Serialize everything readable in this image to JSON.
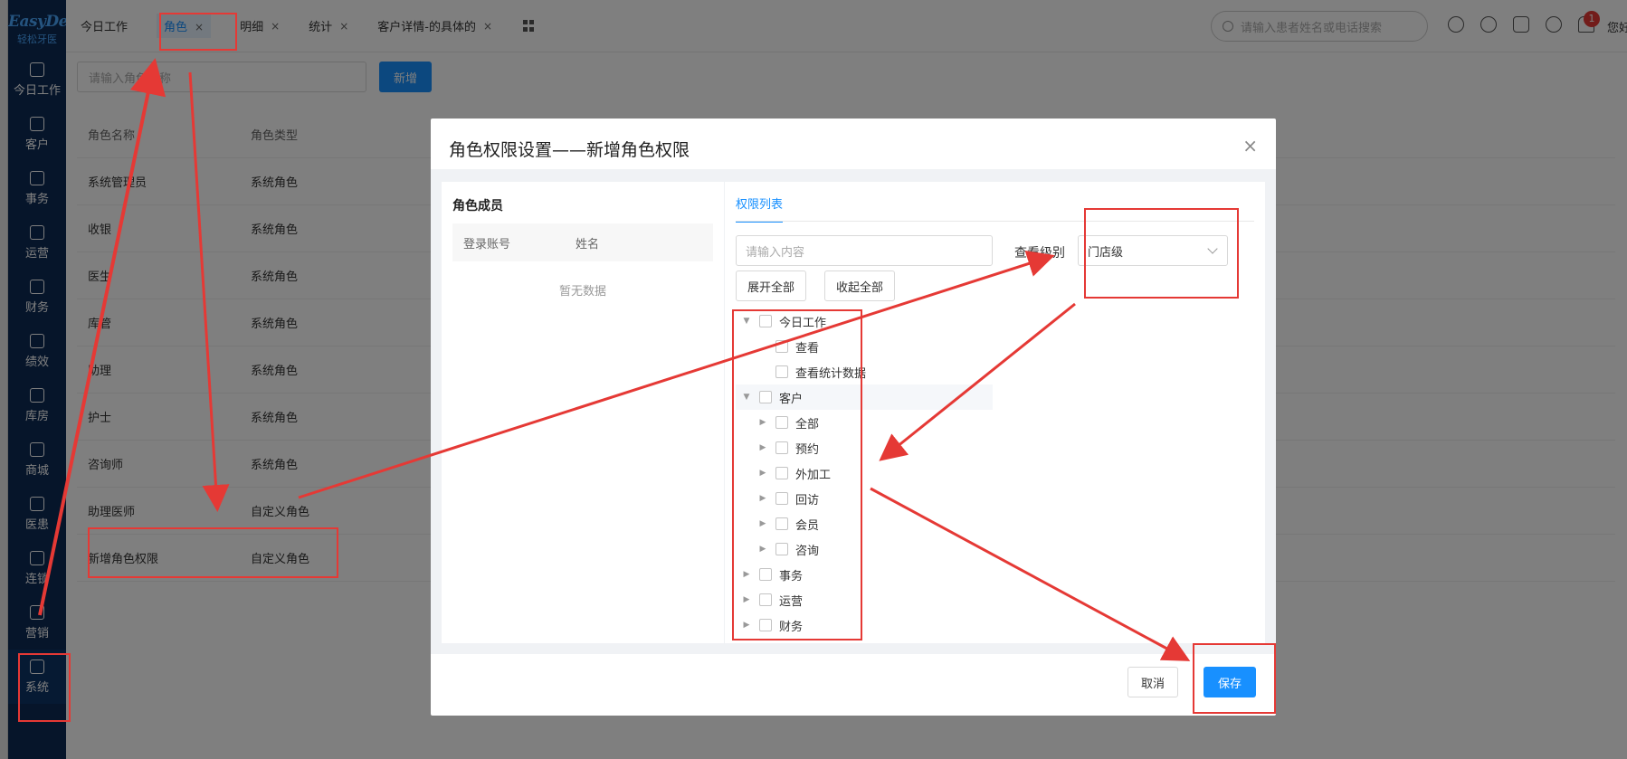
{
  "app": {
    "logo_en": "EasyDent",
    "logo_cn": "轻松牙医"
  },
  "sidebar": {
    "items": [
      {
        "label": "今日工作",
        "icon": "home-icon"
      },
      {
        "label": "客户",
        "icon": "customer-icon"
      },
      {
        "label": "事务",
        "icon": "task-icon"
      },
      {
        "label": "运营",
        "icon": "pie-chart-icon"
      },
      {
        "label": "财务",
        "icon": "finance-icon"
      },
      {
        "label": "绩效",
        "icon": "line-chart-icon"
      },
      {
        "label": "库房",
        "icon": "warehouse-icon"
      },
      {
        "label": "商城",
        "icon": "store-icon"
      },
      {
        "label": "医患",
        "icon": "doctor-patient-icon"
      },
      {
        "label": "连锁",
        "icon": "chain-icon"
      },
      {
        "label": "营销",
        "icon": "target-icon"
      },
      {
        "label": "系统",
        "icon": "gear-icon"
      }
    ]
  },
  "tabs": [
    {
      "label": "今日工作"
    },
    {
      "label": "角色"
    },
    {
      "label": "明细"
    },
    {
      "label": "统计"
    },
    {
      "label": "客户详情-的具体的"
    }
  ],
  "header": {
    "search_placeholder": "请输入患者姓名或电话搜索",
    "notification_count": "1",
    "user_text": "您好"
  },
  "roles": {
    "name_placeholder": "请输入角色名称",
    "add_label": "新增",
    "columns": [
      "角色名称",
      "角色类型"
    ],
    "rows": [
      [
        "系统管理员",
        "系统角色"
      ],
      [
        "收银",
        "系统角色"
      ],
      [
        "医生",
        "系统角色"
      ],
      [
        "库管",
        "系统角色"
      ],
      [
        "助理",
        "系统角色"
      ],
      [
        "护士",
        "系统角色"
      ],
      [
        "咨询师",
        "系统角色"
      ],
      [
        "助理医师",
        "自定义角色"
      ],
      [
        "新增角色权限",
        "自定义角色"
      ]
    ]
  },
  "dialog": {
    "title": "角色权限设置——新增角色权限",
    "close_symbol": "×",
    "members_title": "角色成员",
    "members_columns": [
      "登录账号",
      "姓名"
    ],
    "members_empty": "暂无数据",
    "perm_tab": "权限列表",
    "filter_placeholder": "请输入内容",
    "level_label": "查看级别",
    "level_value": "门店级",
    "expand_all": "展开全部",
    "collapse_all": "收起全部",
    "tree": [
      {
        "label": "今日工作",
        "level": 0,
        "caret": "▼"
      },
      {
        "label": "查看",
        "level": 1,
        "caret": ""
      },
      {
        "label": "查看统计数据",
        "level": 1,
        "caret": ""
      },
      {
        "label": "客户",
        "level": 0,
        "caret": "▼"
      },
      {
        "label": "全部",
        "level": 1,
        "caret": "▶"
      },
      {
        "label": "预约",
        "level": 1,
        "caret": "▶"
      },
      {
        "label": "外加工",
        "level": 1,
        "caret": "▶"
      },
      {
        "label": "回访",
        "level": 1,
        "caret": "▶"
      },
      {
        "label": "会员",
        "level": 1,
        "caret": "▶"
      },
      {
        "label": "咨询",
        "level": 1,
        "caret": "▶"
      },
      {
        "label": "事务",
        "level": 0,
        "caret": "▶"
      },
      {
        "label": "运营",
        "level": 0,
        "caret": "▶"
      },
      {
        "label": "财务",
        "level": 0,
        "caret": "▶"
      }
    ],
    "cancel_label": "取消",
    "save_label": "保存"
  },
  "colors": {
    "sidebar_bg": "#0d2a55",
    "primary": "#1890ff",
    "annotation_red": "#e53935"
  }
}
